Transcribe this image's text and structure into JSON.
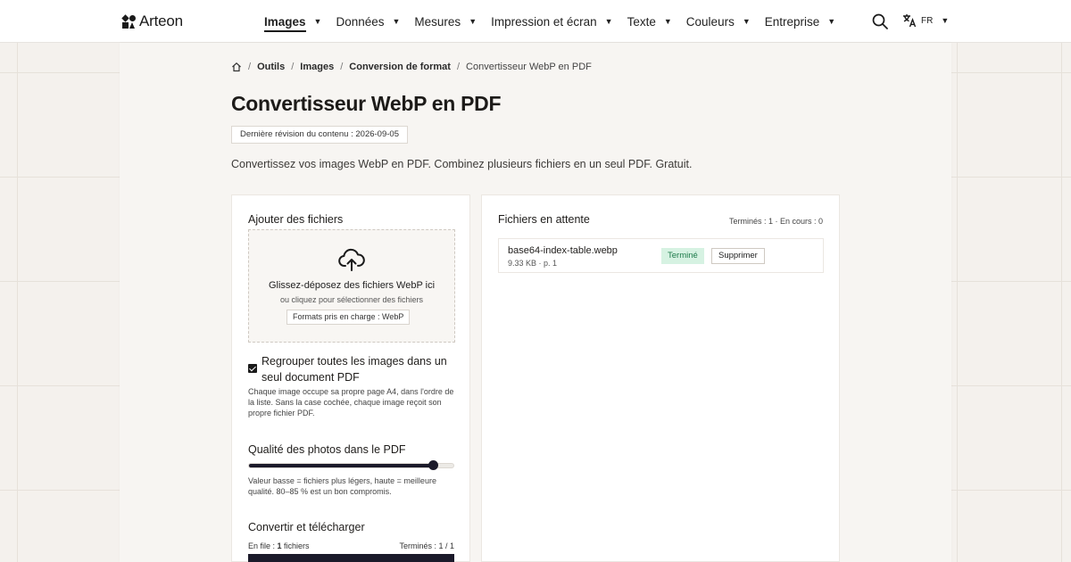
{
  "brand": {
    "name": "Arteon"
  },
  "nav": {
    "items": [
      {
        "label": "Images",
        "active": true
      },
      {
        "label": "Données",
        "active": false
      },
      {
        "label": "Mesures",
        "active": false
      },
      {
        "label": "Impression et écran",
        "active": false
      },
      {
        "label": "Texte",
        "active": false
      },
      {
        "label": "Couleurs",
        "active": false
      },
      {
        "label": "Entreprise",
        "active": false
      }
    ],
    "language": "FR"
  },
  "breadcrumb": [
    "Outils",
    "Images",
    "Conversion de format",
    "Convertisseur WebP en PDF"
  ],
  "page": {
    "title": "Convertisseur WebP en PDF",
    "revision": "Dernière révision du contenu : 2026-09-05",
    "subtitle": "Convertissez vos images WebP en PDF. Combinez plusieurs fichiers en un seul PDF. Gratuit."
  },
  "upload": {
    "title": "Ajouter des fichiers",
    "drop_main": "Glissez-déposez des fichiers WebP ici",
    "drop_sub": "ou cliquez pour sélectionner des fichiers",
    "formats": "Formats pris en charge : WebP"
  },
  "options": {
    "merge_label": "Regrouper toutes les images dans un seul document PDF",
    "merge_checked": true,
    "merge_help": "Chaque image occupe sa propre page A4, dans l'ordre de la liste. Sans la case cochée, chaque image reçoit son propre fichier PDF.",
    "quality_title": "Qualité des photos dans le PDF",
    "quality_value": 0.9,
    "quality_help": "Valeur basse = fichiers plus légers, haute = meilleure qualité. 80–85 % est un bon compromis."
  },
  "convert": {
    "title": "Convertir et télécharger",
    "queue_prefix": "En file : ",
    "queue_count": "1",
    "queue_suffix": " fichiers",
    "done": "Terminés : 1 / 1"
  },
  "queue": {
    "title": "Fichiers en attente",
    "counts": "Terminés : 1 · En cours : 0",
    "files": [
      {
        "name": "base64-index-table.webp",
        "meta": "9.33 KB · p. 1",
        "status": "Terminé",
        "delete_label": "Supprimer"
      }
    ]
  },
  "colors": {
    "accent": "#1b1a2a",
    "success_bg": "#d6f2e2",
    "success_text": "#1d7a4a"
  }
}
